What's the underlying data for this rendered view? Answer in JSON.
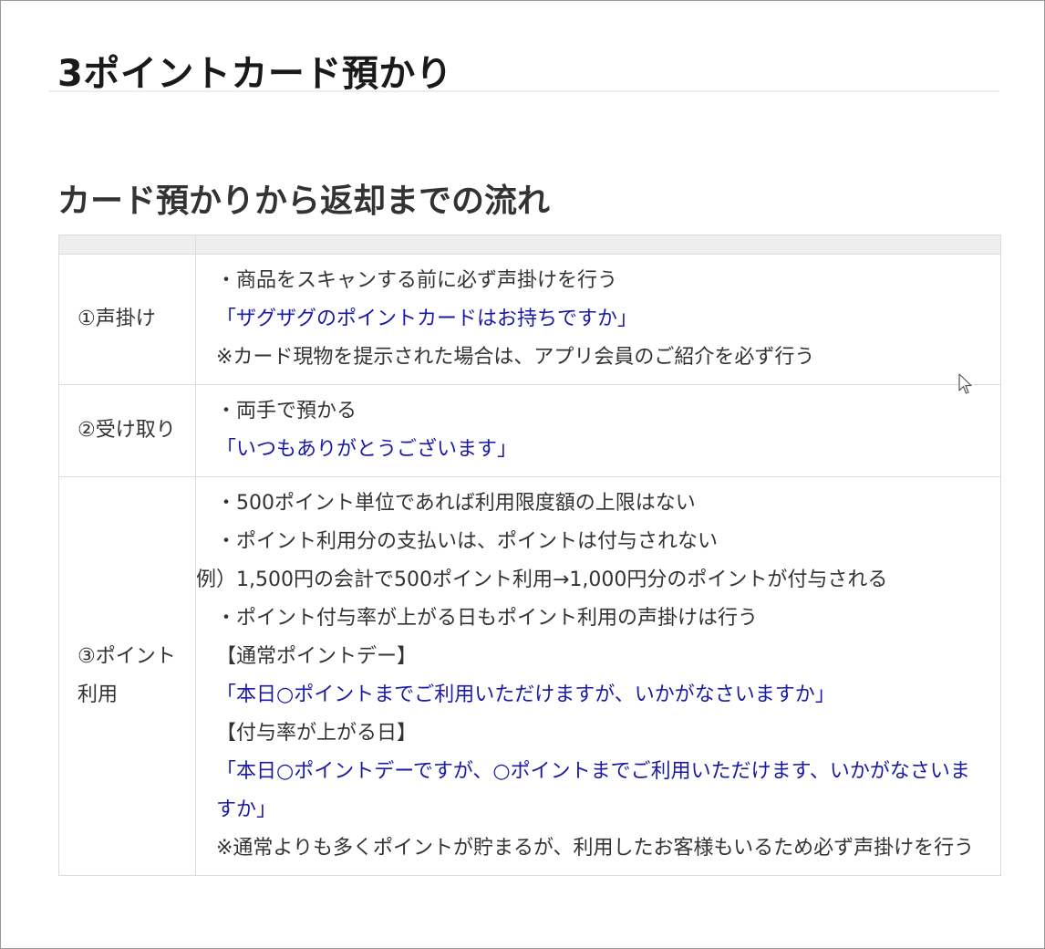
{
  "page": {
    "title": "3ポイントカード預かり",
    "section_heading": "カード預かりから返却までの流れ"
  },
  "steps": [
    {
      "label": "①声掛け",
      "lines": [
        {
          "text": "・商品をスキャンする前に必ず声掛けを行う",
          "kind": "normal"
        },
        {
          "text": "「ザグザグのポイントカードはお持ちですか」",
          "kind": "speech"
        },
        {
          "text": "※カード現物を提示された場合は、アプリ会員のご紹介を必ず行う",
          "kind": "normal"
        }
      ]
    },
    {
      "label": "②受け取り",
      "lines": [
        {
          "text": "・両手で預かる",
          "kind": "normal"
        },
        {
          "text": "「いつもありがとうございます」",
          "kind": "speech"
        }
      ]
    },
    {
      "label": "③ポイント利用",
      "lines": [
        {
          "text": "・500ポイント単位であれば利用限度額の上限はない",
          "kind": "normal"
        },
        {
          "text": "・ポイント利用分の支払いは、ポイントは付与されない",
          "kind": "normal"
        },
        {
          "text": "例）1,500円の会計で500ポイント利用→1,000円分のポイントが付与される",
          "kind": "normal"
        },
        {
          "text": "・ポイント付与率が上がる日もポイント利用の声掛けは行う",
          "kind": "normal"
        },
        {
          "text": "【通常ポイントデー】",
          "kind": "normal"
        },
        {
          "text": "「本日○ポイントまでご利用いただけますが、いかがなさいますか」",
          "kind": "speech"
        },
        {
          "text": "【付与率が上がる日】",
          "kind": "normal"
        },
        {
          "text": "「本日○ポイントデーですが、○ポイントまでご利用いただけます、いかがなさいますか」",
          "kind": "speech"
        },
        {
          "text": "※通常よりも多くポイントが貯まるが、利用したお客様もいるため必ず声掛けを行う",
          "kind": "normal"
        }
      ]
    }
  ],
  "colors": {
    "speech_text": "#1a1aa6",
    "body_text": "#333333",
    "header_row_bg": "#eeeeee"
  },
  "icons": {
    "cursor": "mouse-pointer-icon"
  }
}
